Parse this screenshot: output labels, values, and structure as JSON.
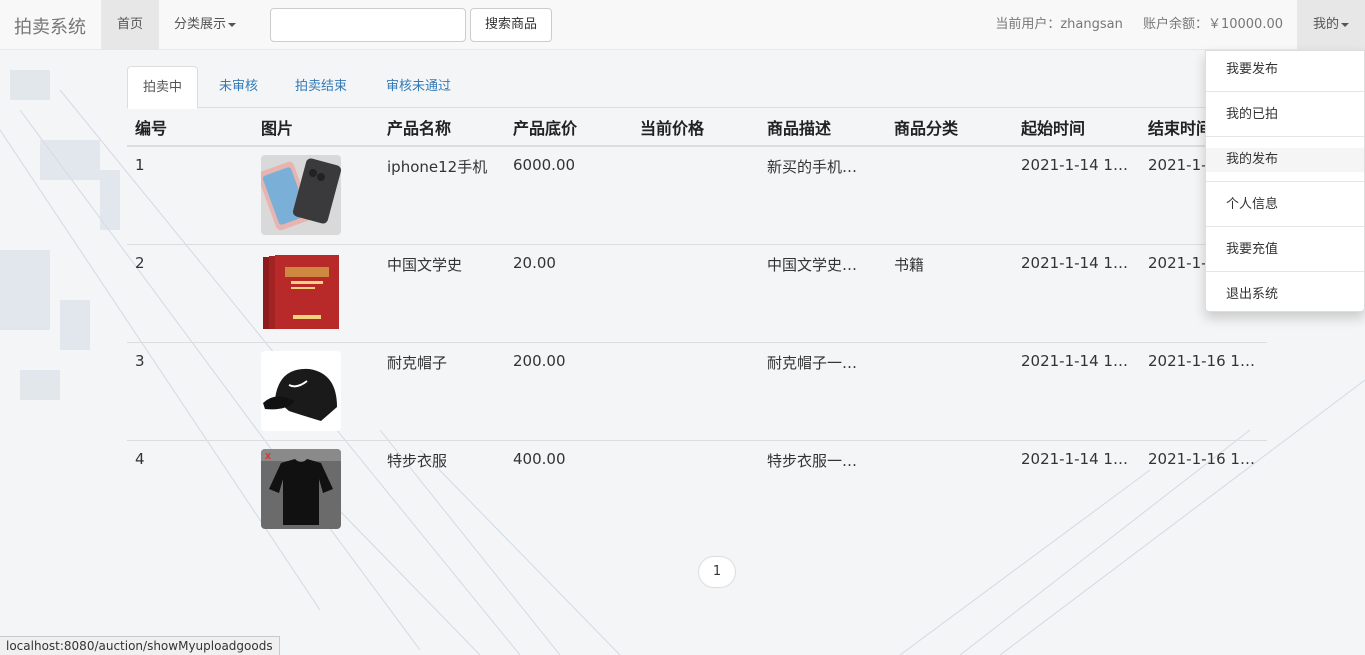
{
  "navbar": {
    "brand": "拍卖系统",
    "home": "首页",
    "category": "分类展示",
    "search_placeholder": "",
    "search_button": "搜索商品",
    "current_user": "当前用户：zhangsan",
    "balance": "账户余额：￥10000.00",
    "mine": "我的"
  },
  "dropdown": {
    "items": [
      "我要发布",
      "我的已拍",
      "我的发布",
      "个人信息",
      "我要充值",
      "退出系统"
    ],
    "active_index": 2
  },
  "tabs": [
    "拍卖中",
    "未审核",
    "拍卖结束",
    "审核未通过"
  ],
  "table": {
    "headers": [
      "编号",
      "图片",
      "产品名称",
      "产品底价",
      "当前价格",
      "商品描述",
      "商品分类",
      "起始时间",
      "结束时间"
    ],
    "rows": [
      {
        "id": "1",
        "name": "iphone12手机",
        "base_price": "6000.00",
        "current_price": "",
        "desc": "新买的手机…",
        "category": "",
        "start": "2021-1-14 1…",
        "end": "2021-1-1",
        "image": "phone-image"
      },
      {
        "id": "2",
        "name": "中国文学史",
        "base_price": "20.00",
        "current_price": "",
        "desc": "中国文学史…",
        "category": "书籍",
        "start": "2021-1-14 1…",
        "end": "2021-1-",
        "image": "book-image"
      },
      {
        "id": "3",
        "name": "耐克帽子",
        "base_price": "200.00",
        "current_price": "",
        "desc": "耐克帽子一…",
        "category": "",
        "start": "2021-1-14 1…",
        "end": "2021-1-16 1…",
        "image": "cap-image"
      },
      {
        "id": "4",
        "name": "特步衣服",
        "base_price": "400.00",
        "current_price": "",
        "desc": "特步衣服一…",
        "category": "",
        "start": "2021-1-14 1…",
        "end": "2021-1-16 1…",
        "image": "shirt-image"
      }
    ]
  },
  "pagination": {
    "current": "1"
  },
  "status_bar": "localhost:8080/auction/showMyuploadgoods",
  "colors": {
    "link": "#337ab7",
    "navbar_bg": "#f8f8f8",
    "active_nav": "#e7e7e7"
  }
}
